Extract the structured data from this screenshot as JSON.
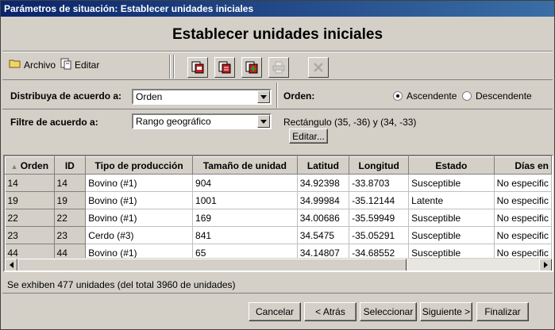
{
  "window": {
    "title": "Parámetros de situación: Establecer unidades iniciales"
  },
  "header": {
    "title": "Establecer unidades iniciales"
  },
  "toolbar": {
    "file_label": "Archivo",
    "edit_label": "Editar"
  },
  "distribute": {
    "label": "Distribuya de acuerdo a:",
    "selected": "Orden",
    "order_label": "Orden:",
    "asc_label": "Ascendente",
    "desc_label": "Descendente",
    "order_selected": "asc"
  },
  "filter": {
    "label": "Filtre de acuerdo a:",
    "selected": "Rango geográfico",
    "rect_text": "Rectángulo (35, -36) y (34, -33)",
    "edit_button": "Editar..."
  },
  "table": {
    "columns": [
      "Orden",
      "ID",
      "Tipo de producción",
      "Tamaño de unidad",
      "Latitud",
      "Longitud",
      "Estado",
      "Días en"
    ],
    "rows": [
      [
        "14",
        "14",
        "Bovino (#1)",
        "904",
        "34.92398",
        "-33.8703",
        "Susceptible",
        "No especific"
      ],
      [
        "19",
        "19",
        "Bovino (#1)",
        "1001",
        "34.99984",
        "-35.12144",
        "Latente",
        "No especific"
      ],
      [
        "22",
        "22",
        "Bovino (#1)",
        "169",
        "34.00686",
        "-35.59949",
        "Susceptible",
        "No especific"
      ],
      [
        "23",
        "23",
        "Cerdo (#3)",
        "841",
        "34.5475",
        "-35.05291",
        "Susceptible",
        "No especific"
      ],
      [
        "44",
        "44",
        "Bovino (#1)",
        "65",
        "34.14807",
        "-34.68552",
        "Susceptible",
        "No especific"
      ]
    ]
  },
  "status": {
    "text": "Se exhiben 477 unidades (del total 3960 de unidades)"
  },
  "footer": {
    "cancel": "Cancelar",
    "back": "< Atrás",
    "select": "Seleccionar",
    "next": "Siguiente >",
    "finish": "Finalizar"
  }
}
